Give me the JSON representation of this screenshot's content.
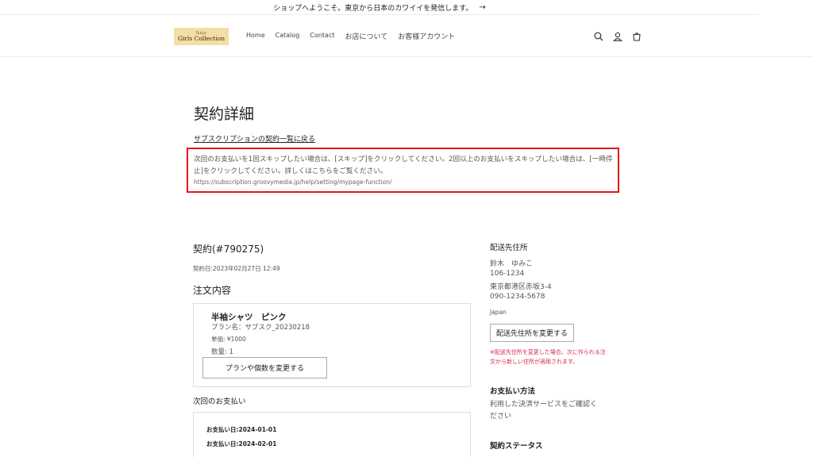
{
  "announcement": {
    "text": "ショップへようこそ。東京から日本のカワイイを発信します。",
    "arrow": "→"
  },
  "header": {
    "logo": {
      "small": "Tokyo",
      "brand": "Girls Collection",
      "bg_color": "#f3dea5"
    },
    "nav": [
      "Home",
      "Catalog",
      "Contact",
      "お店について",
      "お客様アカウント"
    ],
    "icons": [
      "search-icon",
      "account-icon",
      "cart-icon"
    ]
  },
  "page": {
    "title": "契約詳細",
    "back_link": "サブスクリプションの契約一覧に戻る",
    "notice": {
      "text": "次回のお支払いを1回スキップしたい場合は、[スキップ]をクリックしてください。2回以上のお支払いをスキップしたい場合は、[一時停止]をクリックしてください。詳しくはこちらをご覧ください。",
      "url": "https://subscription.groovymedia.jp/help/setting/mypage-function/",
      "border_color": "#e8161c"
    }
  },
  "contract": {
    "heading": "契約(#790275)",
    "date": "契約日:2023年02月27日 12:49",
    "order_heading": "注文内容",
    "item": {
      "name": "半袖シャツ　ピンク",
      "plan": "プラン名：サブスク_20230218",
      "price": "単価: ¥1000",
      "qty": "数量: 1",
      "change_button": "プランや個数を変更する"
    },
    "next_payment_heading": "次回のお支払い",
    "payments": [
      "お支払い日:2024-01-01",
      "お支払い日:2024-02-01"
    ]
  },
  "sidebar": {
    "shipping_heading": "配送先住所",
    "name": "鈴木　ゆみこ",
    "postal": "106-1234",
    "address": "東京都港区赤坂3-4",
    "phone": "090-1234-5678",
    "country": "Japan",
    "change_address_button": "配送先住所を変更する",
    "warning": "※配送先住所を変更した場合、次に作られる注文から新しい住所が適用されます。",
    "warning_color": "#d6284a",
    "payment_method_heading": "お支払い方法",
    "payment_method_text": "利用した決済サービスをご確認ください",
    "status_heading": "契約ステータス"
  }
}
